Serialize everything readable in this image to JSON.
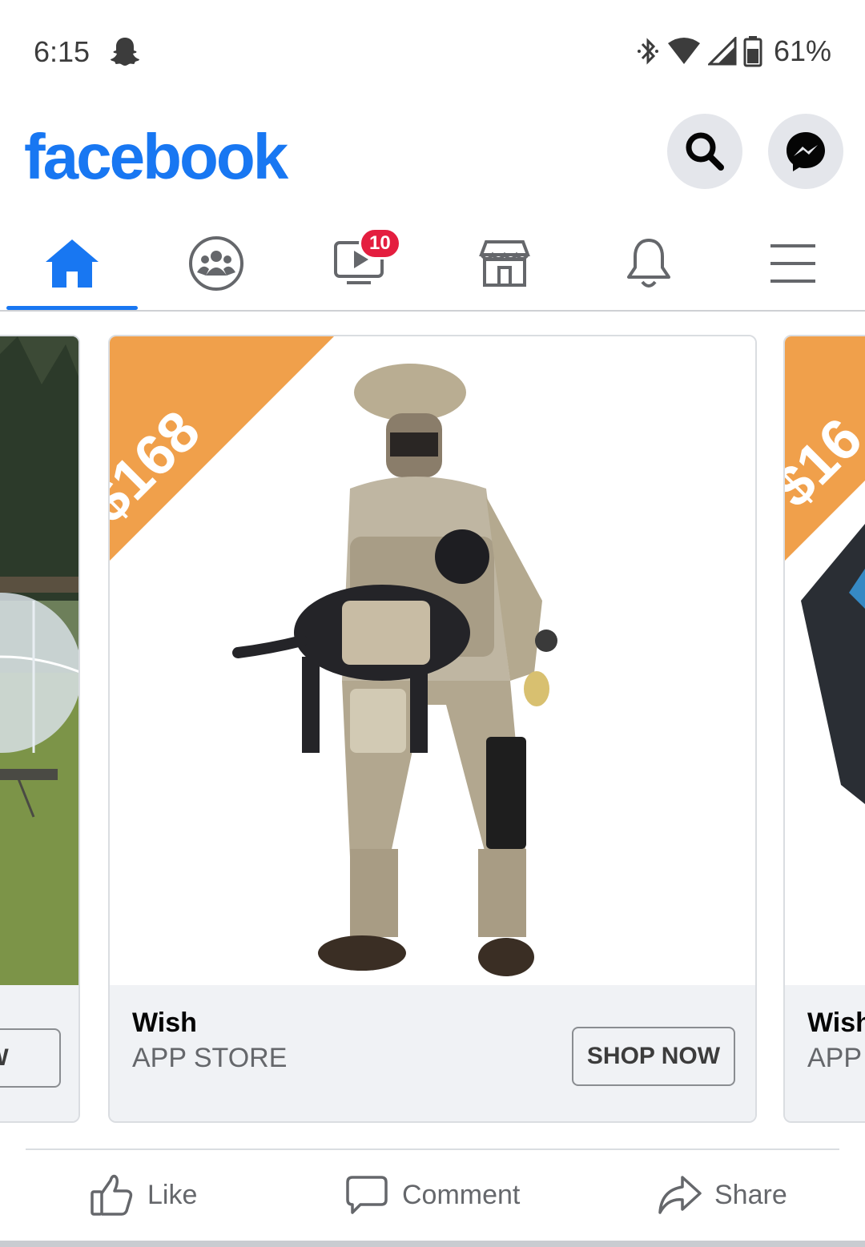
{
  "status_bar": {
    "time": "6:15",
    "notification_icon": "snapchat-ghost-icon",
    "bluetooth_icon": "bluetooth-icon",
    "wifi_icon": "wifi-icon",
    "signal_icon": "cell-signal-icon",
    "battery_icon": "battery-icon",
    "battery": "61%"
  },
  "header": {
    "logo": "facebook",
    "search_icon": "search-icon",
    "messenger_icon": "messenger-icon",
    "brand_color": "#1877f2"
  },
  "nav": {
    "tabs": [
      {
        "icon": "home-icon",
        "active": true
      },
      {
        "icon": "groups-icon",
        "active": false
      },
      {
        "icon": "watch-icon",
        "active": false,
        "badge": "10"
      },
      {
        "icon": "marketplace-icon",
        "active": false
      },
      {
        "icon": "notifications-bell-icon",
        "active": false
      },
      {
        "icon": "menu-icon",
        "active": false
      }
    ]
  },
  "carousel": {
    "cards": [
      {
        "title": "",
        "subtitle": "",
        "button": "NOW",
        "image": "bubble tent on lawn"
      },
      {
        "price": "$168",
        "title": "Wish",
        "subtitle": "APP STORE",
        "button": "SHOP NOW",
        "image": "soldier action figure with dog"
      },
      {
        "price": "$16",
        "title": "Wish",
        "subtitle": "APP",
        "image": "dark device"
      }
    ],
    "price_tag_color": "#f0a04b"
  },
  "actions": {
    "like": "Like",
    "comment": "Comment",
    "share": "Share"
  }
}
